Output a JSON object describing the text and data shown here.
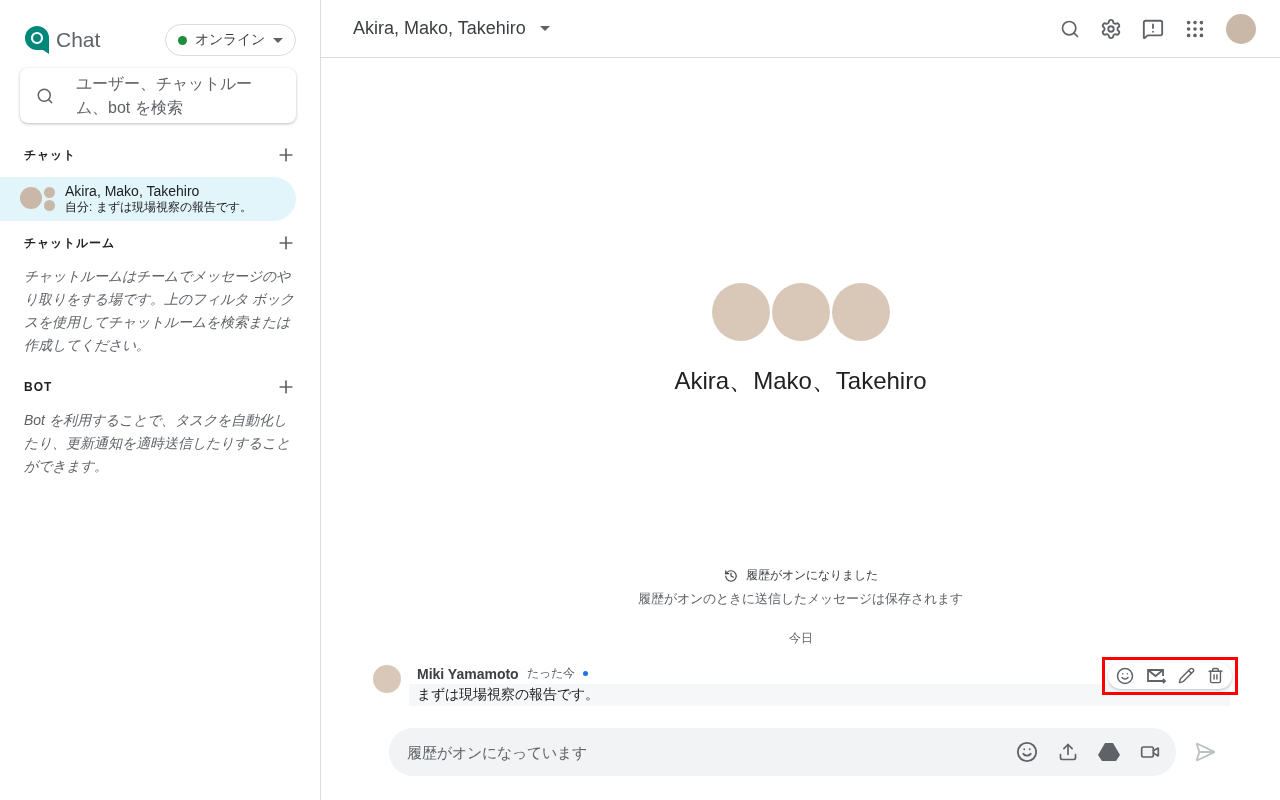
{
  "app": {
    "name": "Chat"
  },
  "status": {
    "label": "オンライン"
  },
  "search": {
    "placeholder": "ユーザー、チャットルーム、bot を検索"
  },
  "sections": [
    {
      "title": "チャット",
      "items": [
        {
          "name": "Akira, Mako, Takehiro",
          "preview": "自分: まずは現場視察の報告です。",
          "selected": true
        }
      ]
    },
    {
      "title": "チャットルーム",
      "description": "チャットルームはチームでメッセージのやり取りをする場です。上のフィルタ ボックスを使用してチャットルームを検索または作成してください。"
    },
    {
      "title": "BOT",
      "description": "Bot を利用することで、タスクを自動化したり、更新通知を適時送信したりすることができます。"
    }
  ],
  "conversation": {
    "title": "Akira, Mako, Takehiro",
    "heading": "Akira、Mako、Takehiro"
  },
  "history": {
    "title": "履歴がオンになりました",
    "subtitle": "履歴がオンのときに送信したメッセージは保存されます"
  },
  "date_divider": "今日",
  "messages": [
    {
      "author": "Miki Yamamoto",
      "time": "たった今",
      "text": "まずは現場視察の報告です。",
      "unread": true,
      "highlighted": true
    }
  ],
  "composer": {
    "placeholder": "履歴がオンになっています"
  }
}
